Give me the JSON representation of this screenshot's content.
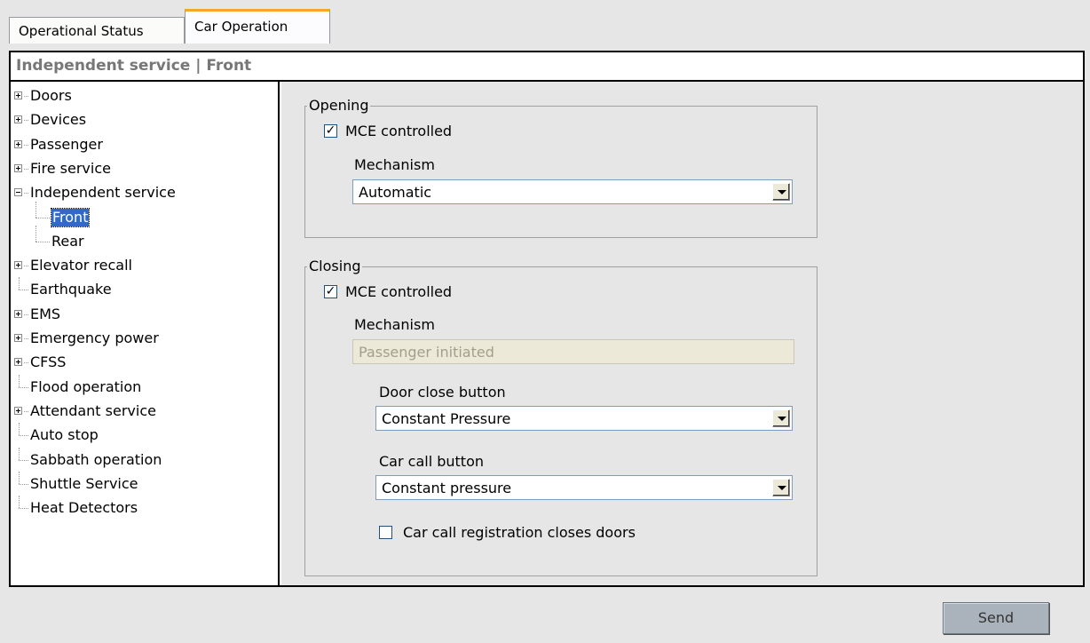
{
  "tabs": [
    {
      "label": "Operational Status",
      "active": false
    },
    {
      "label": "Car Operation",
      "active": true
    }
  ],
  "header": {
    "title": "Independent service | Front"
  },
  "tree": {
    "items": [
      {
        "label": "Doors",
        "expander": "plus"
      },
      {
        "label": "Devices",
        "expander": "plus"
      },
      {
        "label": "Passenger",
        "expander": "plus"
      },
      {
        "label": "Fire service",
        "expander": "plus"
      },
      {
        "label": "Independent service",
        "expander": "minus"
      },
      {
        "label": "Front",
        "child": true,
        "selected": true
      },
      {
        "label": "Rear",
        "child": true
      },
      {
        "label": "Elevator recall",
        "expander": "plus"
      },
      {
        "label": "Earthquake",
        "expander": "none"
      },
      {
        "label": "EMS",
        "expander": "plus"
      },
      {
        "label": "Emergency power",
        "expander": "plus"
      },
      {
        "label": "CFSS",
        "expander": "plus"
      },
      {
        "label": "Flood operation",
        "expander": "none"
      },
      {
        "label": "Attendant service",
        "expander": "plus"
      },
      {
        "label": "Auto stop",
        "expander": "none"
      },
      {
        "label": "Sabbath operation",
        "expander": "none"
      },
      {
        "label": "Shuttle Service",
        "expander": "none"
      },
      {
        "label": "Heat Detectors",
        "expander": "none"
      }
    ]
  },
  "opening": {
    "legend": "Opening",
    "mce_label": "MCE controlled",
    "mce_checked": true,
    "mechanism_label": "Mechanism",
    "mechanism_value": "Automatic"
  },
  "closing": {
    "legend": "Closing",
    "mce_label": "MCE controlled",
    "mce_checked": true,
    "mechanism_label": "Mechanism",
    "mechanism_value": "Passenger initiated",
    "door_close_label": "Door close button",
    "door_close_value": "Constant Pressure",
    "car_call_label": "Car call button",
    "car_call_value": "Constant pressure",
    "registration_label": "Car call registration closes doors",
    "registration_checked": false
  },
  "actions": {
    "send_label": "Send"
  },
  "colors": {
    "selection": "#316ac5",
    "active_tab_accent": "#f5a623",
    "panel_bg": "#e6e6e6"
  }
}
